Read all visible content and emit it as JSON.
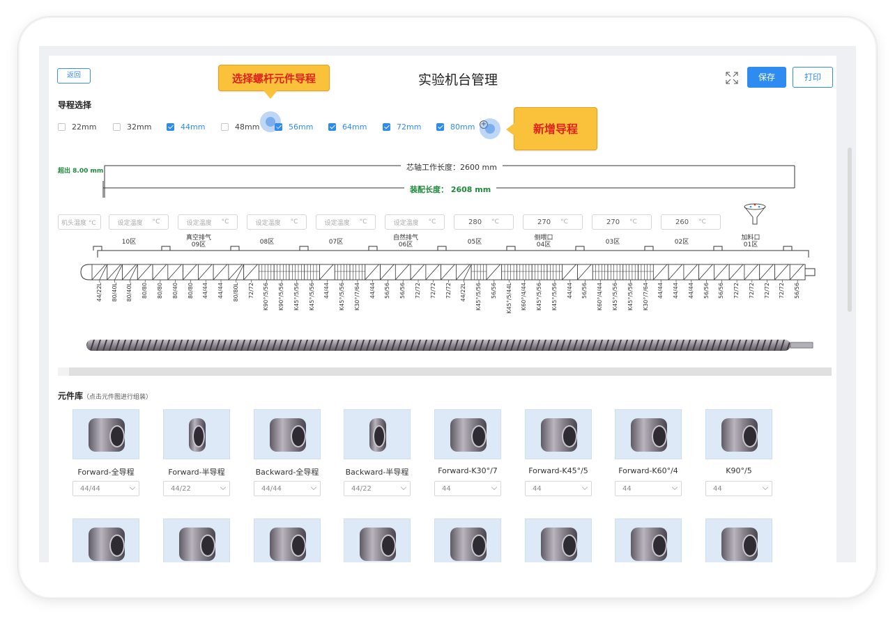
{
  "page": {
    "title": "实验机台管理",
    "back_label": "返回",
    "save_label": "保存",
    "print_label": "打印"
  },
  "lead_select": {
    "title": "导程选择",
    "options": [
      {
        "label": "22mm",
        "checked": false
      },
      {
        "label": "32mm",
        "checked": false
      },
      {
        "label": "44mm",
        "checked": true
      },
      {
        "label": "48mm",
        "checked": false
      },
      {
        "label": "56mm",
        "checked": true
      },
      {
        "label": "64mm",
        "checked": true
      },
      {
        "label": "72mm",
        "checked": true
      },
      {
        "label": "80mm",
        "checked": true
      }
    ],
    "add_icon": "plus-circle-icon"
  },
  "callouts": {
    "select_lead": "选择螺杆元件导程",
    "add_lead": "新增导程"
  },
  "dimensions": {
    "exceed": "超出 8.00 mm",
    "core_length": "芯轴工作长度：2600 mm",
    "assembly_length": "装配长度：  2608 mm"
  },
  "temps": {
    "head_placeholder": "机头温度 °C",
    "unit": "°C",
    "setpoint_placeholder": "设定温度",
    "values": [
      "",
      "",
      "",
      "",
      "",
      "280",
      "270",
      "270",
      "260"
    ]
  },
  "zones": [
    {
      "name": "10区",
      "note": ""
    },
    {
      "name": "09区",
      "note": "真空排气"
    },
    {
      "name": "08区",
      "note": ""
    },
    {
      "name": "07区",
      "note": ""
    },
    {
      "name": "06区",
      "note": "自然排气"
    },
    {
      "name": "05区",
      "note": ""
    },
    {
      "name": "04区",
      "note": "侧喂口"
    },
    {
      "name": "03区",
      "note": ""
    },
    {
      "name": "02区",
      "note": ""
    },
    {
      "name": "01区",
      "note": "加料口"
    }
  ],
  "element_specs": [
    "44/22L",
    "80/40L",
    "80/40L",
    "80/80",
    "80/80",
    "80/40",
    "80/80",
    "44/44",
    "44/44",
    "80/80L",
    "72/72",
    "K90°/5/56",
    "K90°/5/56",
    "K45°/5/56",
    "K45°/5/56",
    "44/44",
    "K45°/5/56",
    "K30°/7/64",
    "44/44",
    "56/56",
    "56/56",
    "72/72",
    "72/72",
    "72/72",
    "44/22L",
    "K45°/5/56",
    "56/56",
    "K45°/5/44L",
    "K60°/4/44",
    "K45°/5/56",
    "K45°/5/56",
    "44/44",
    "56/56",
    "K60°/4/44",
    "K45°/5/56",
    "K45°/5/56",
    "K30°/7/64",
    "44/44",
    "44/44",
    "44/44",
    "56/56",
    "56/56",
    "72/72",
    "72/72",
    "72/72",
    "72/72",
    "56/56"
  ],
  "library": {
    "title": "元件库",
    "hint": "（点击元件图进行组装）",
    "items": [
      {
        "name": "Forward-全导程",
        "value": "44/44"
      },
      {
        "name": "Forward-半导程",
        "value": "44/22"
      },
      {
        "name": "Backward-全导程",
        "value": "44/44"
      },
      {
        "name": "Backward-半导程",
        "value": "44/22"
      },
      {
        "name": "Forward-K30°/7",
        "value": "44"
      },
      {
        "name": "Forward-K45°/5",
        "value": "44"
      },
      {
        "name": "Forward-K60°/4",
        "value": "44"
      },
      {
        "name": "K90°/5",
        "value": "44"
      }
    ]
  },
  "colors": {
    "accent": "#2e8cf0",
    "callout_bg": "#fac13a",
    "callout_text": "#e0221f",
    "ok_green": "#1d8a3a"
  }
}
